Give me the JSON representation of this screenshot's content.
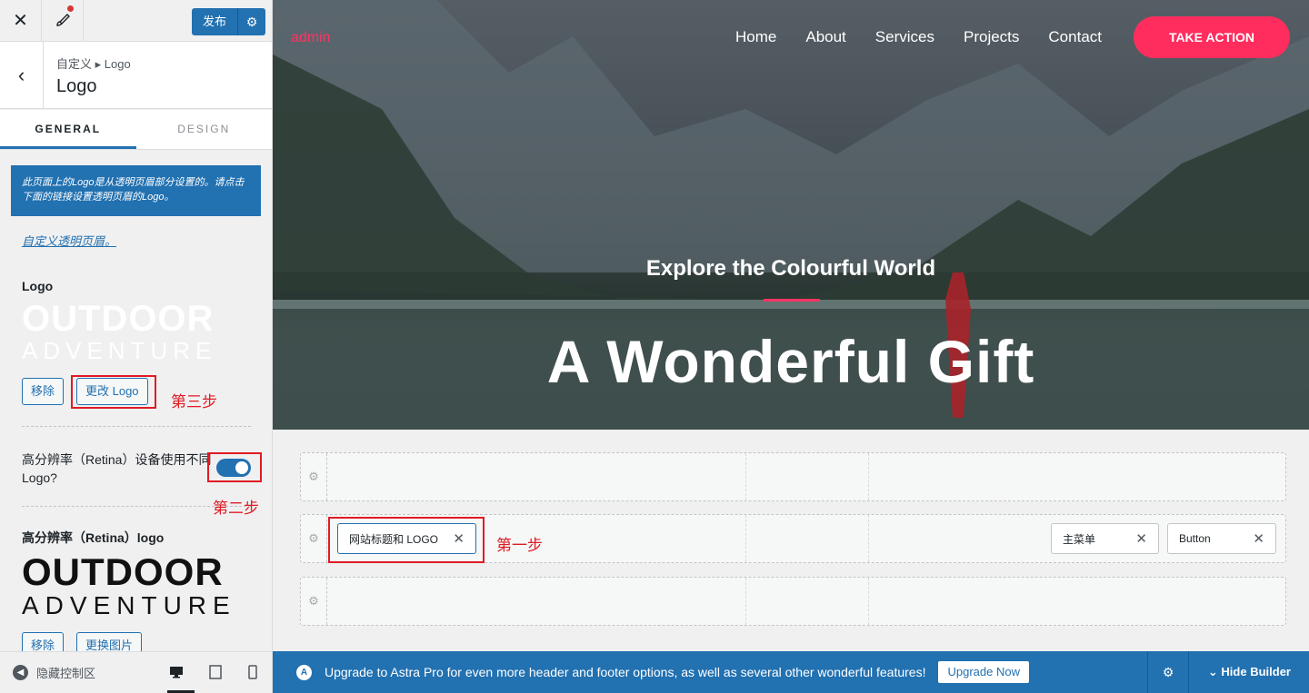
{
  "topbar": {
    "publish_label": "发布"
  },
  "section": {
    "breadcrumb": "自定义 ▸ Logo",
    "title": "Logo"
  },
  "tabs": [
    {
      "label": "GENERAL"
    },
    {
      "label": "DESIGN"
    }
  ],
  "notice": "此页面上的Logo是从透明页眉部分设置的。请点击下面的链接设置透明页眉的Logo。",
  "notice_link": "自定义透明页眉。",
  "logo_control": {
    "label": "Logo",
    "preview_line1": "OUTDOOR",
    "preview_line2": "ADVENTURE",
    "remove_label": "移除",
    "change_label": "更改 Logo"
  },
  "retina_toggle": {
    "label": "高分辨率（Retina）设备使用不同Logo?",
    "enabled": true
  },
  "retina_logo": {
    "label": "高分辨率（Retina）logo",
    "preview_line1": "OUTDOOR",
    "preview_line2": "ADVENTURE",
    "remove_label": "移除",
    "replace_label": "更换图片"
  },
  "annotations": {
    "step1": "第一步",
    "step2": "第二步",
    "step3": "第三步"
  },
  "footer": {
    "collapse_label": "隐藏控制区"
  },
  "preview": {
    "site_title": "admin",
    "nav": [
      "Home",
      "About",
      "Services",
      "Projects",
      "Contact"
    ],
    "cta_label": "TAKE ACTION",
    "hero_subtitle": "Explore the Colourful World",
    "hero_title": "A Wonderful Gift"
  },
  "builder": {
    "chip_logo": "网站标题和 LOGO",
    "chip_menu": "主菜单",
    "chip_button": "Button"
  },
  "upgrade": {
    "text": "Upgrade to Astra Pro for even more header and footer options, as well as several other wonderful features!",
    "button_label": "Upgrade Now",
    "hide_label": "Hide Builder"
  },
  "colors": {
    "accent": "#2271b1",
    "brand": "#ff2d5e",
    "annotation": "#e01b24"
  }
}
